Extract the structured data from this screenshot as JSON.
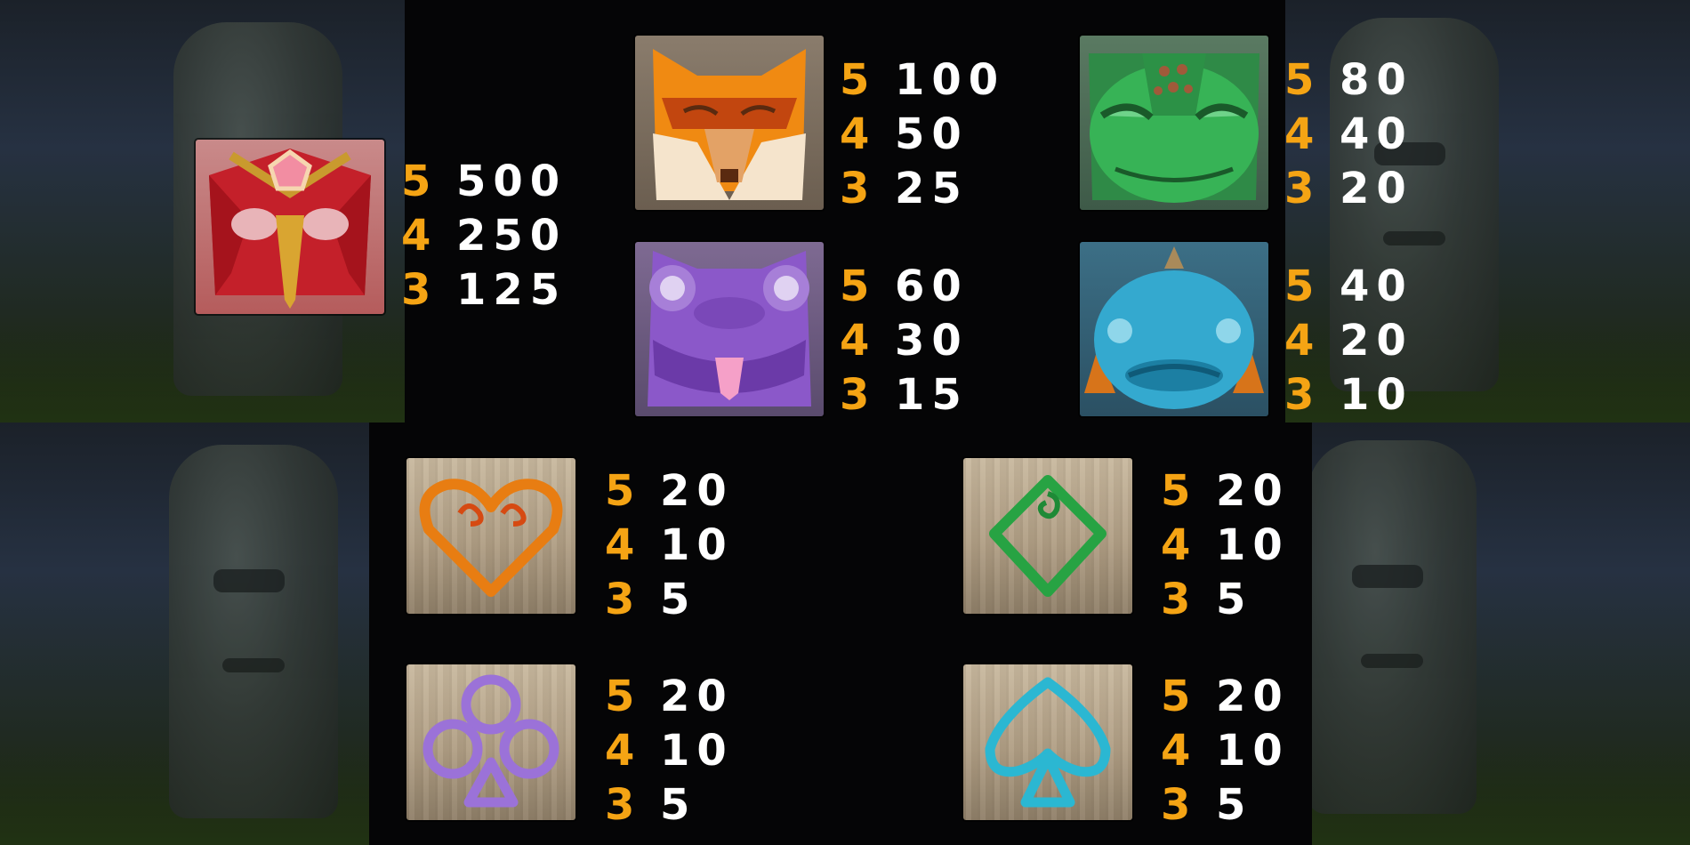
{
  "colors": {
    "count_color": "#f5a414",
    "amount_color": "#ffffff",
    "panel_bg": "#050506"
  },
  "symbols": [
    {
      "id": "owl",
      "icon": "red-owl-mask-icon",
      "pays": [
        {
          "count": "5",
          "amount": "500"
        },
        {
          "count": "4",
          "amount": "250"
        },
        {
          "count": "3",
          "amount": "125"
        }
      ]
    },
    {
      "id": "fox",
      "icon": "orange-fox-mask-icon",
      "pays": [
        {
          "count": "5",
          "amount": "100"
        },
        {
          "count": "4",
          "amount": "50"
        },
        {
          "count": "3",
          "amount": "25"
        }
      ]
    },
    {
      "id": "frog",
      "icon": "green-frog-mask-icon",
      "pays": [
        {
          "count": "5",
          "amount": "80"
        },
        {
          "count": "4",
          "amount": "40"
        },
        {
          "count": "3",
          "amount": "20"
        }
      ]
    },
    {
      "id": "toad",
      "icon": "purple-toad-mask-icon",
      "pays": [
        {
          "count": "5",
          "amount": "60"
        },
        {
          "count": "4",
          "amount": "30"
        },
        {
          "count": "3",
          "amount": "15"
        }
      ]
    },
    {
      "id": "fish",
      "icon": "blue-fish-mask-icon",
      "pays": [
        {
          "count": "5",
          "amount": "40"
        },
        {
          "count": "4",
          "amount": "20"
        },
        {
          "count": "3",
          "amount": "10"
        }
      ]
    },
    {
      "id": "heart",
      "icon": "orange-heart-icon",
      "pays": [
        {
          "count": "5",
          "amount": "20"
        },
        {
          "count": "4",
          "amount": "10"
        },
        {
          "count": "3",
          "amount": "5"
        }
      ]
    },
    {
      "id": "diamond",
      "icon": "green-diamond-icon",
      "pays": [
        {
          "count": "5",
          "amount": "20"
        },
        {
          "count": "4",
          "amount": "10"
        },
        {
          "count": "3",
          "amount": "5"
        }
      ]
    },
    {
      "id": "club",
      "icon": "purple-club-icon",
      "pays": [
        {
          "count": "5",
          "amount": "20"
        },
        {
          "count": "4",
          "amount": "10"
        },
        {
          "count": "3",
          "amount": "5"
        }
      ]
    },
    {
      "id": "spade",
      "icon": "blue-spade-icon",
      "pays": [
        {
          "count": "5",
          "amount": "20"
        },
        {
          "count": "4",
          "amount": "10"
        },
        {
          "count": "3",
          "amount": "5"
        }
      ]
    }
  ]
}
